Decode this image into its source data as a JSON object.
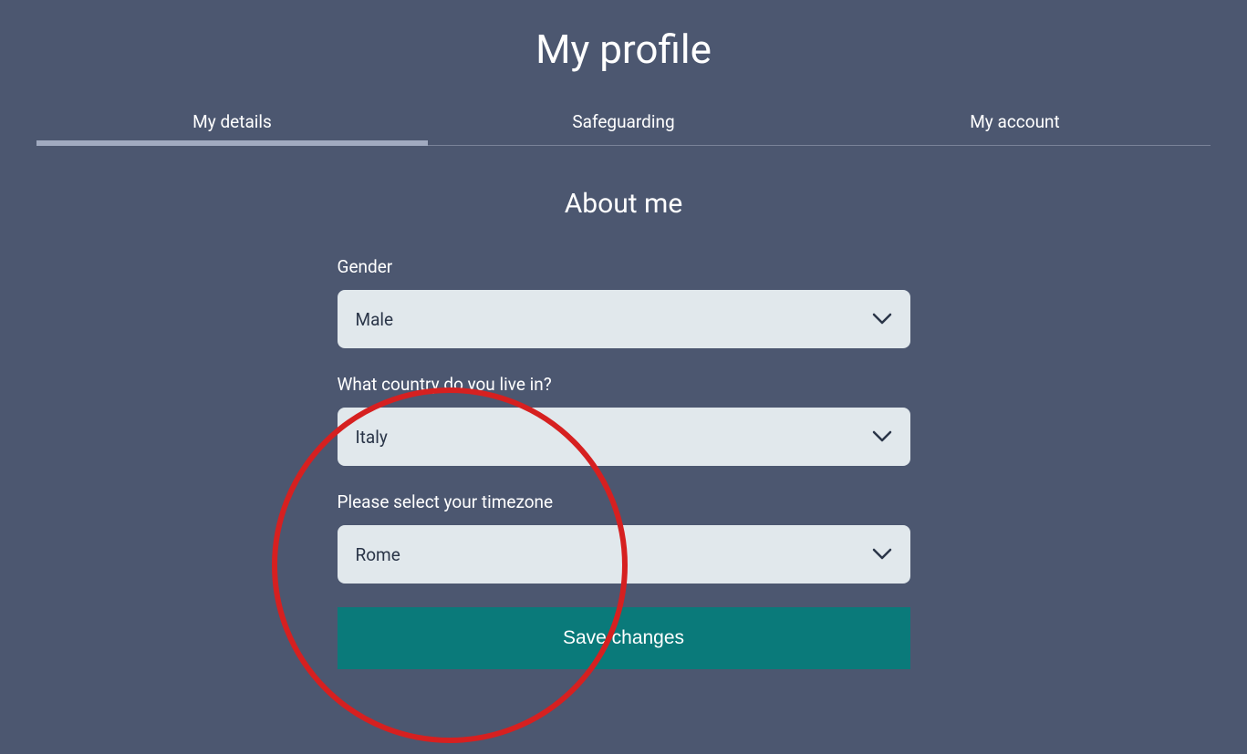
{
  "header": {
    "title": "My profile"
  },
  "tabs": [
    {
      "label": "My details",
      "active": true
    },
    {
      "label": "Safeguarding",
      "active": false
    },
    {
      "label": "My account",
      "active": false
    }
  ],
  "section": {
    "title": "About me"
  },
  "form": {
    "gender": {
      "label": "Gender",
      "value": "Male"
    },
    "country": {
      "label": "What country do you live in?",
      "value": "Italy"
    },
    "timezone": {
      "label": "Please select your timezone",
      "value": "Rome"
    },
    "save_label": "Save changes"
  }
}
